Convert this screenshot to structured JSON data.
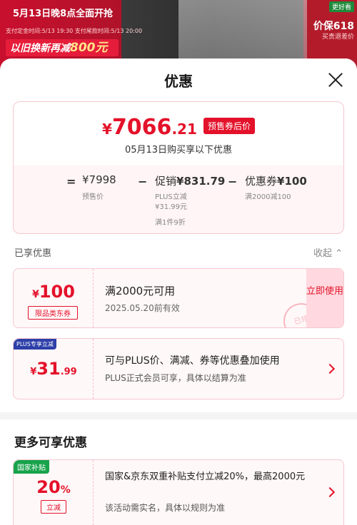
{
  "background": {
    "banner_line1": "5月13日晚8点全面开抢",
    "banner_line2": "支付定金时间:5/13 19:30   支付尾款时间:5/13 20:00",
    "banner_promo_prefix": "以旧换新再减",
    "banner_promo_amount": "800元",
    "right_badge": "更好看",
    "right_big": "价保618",
    "right_small": "买贵退差价"
  },
  "sheet": {
    "title": "优惠"
  },
  "summary": {
    "currency": "¥",
    "price_int": "7066",
    "price_dec": ".21",
    "price_tag": "预售券后价",
    "buy_date": "05月13日购买享以下优惠",
    "equals": "=",
    "presale_price": "¥7998",
    "presale_label": "预售价",
    "minus1": "−",
    "promo_label": "促销",
    "promo_amount": "¥831.79",
    "promo_sub1": "PLUS立减",
    "promo_sub2": "¥31.99元",
    "promo_sub3": "满1件9折",
    "minus2": "−",
    "coupon_label": "优惠券",
    "coupon_amount": "¥100",
    "coupon_sub": "满2000减100"
  },
  "enjoyed": {
    "title": "已享优惠",
    "collapse": "收起"
  },
  "coupons": [
    {
      "currency": "¥",
      "amount": "100",
      "limit": "限品类东券",
      "condition": "满2000元可用",
      "expiry": "2025.05.20前有效",
      "action": "立即使用",
      "stamp": "已领"
    },
    {
      "tag": "PLUS专享立减",
      "currency": "¥",
      "amount_int": "31",
      "amount_dec": ".99",
      "desc1": "可与PLUS价、满减、券等优惠叠加使用",
      "desc2": "PLUS正式会员可享，具体以结算为准"
    }
  ],
  "more": {
    "title": "更多可享优惠",
    "item": {
      "tag": "国家补贴",
      "amount": "20",
      "unit": "%",
      "kind": "立减",
      "desc1": "国家&京东双重补贴支付立减20%，最高2000元",
      "desc2": "该活动需实名，具体以规则为准"
    }
  },
  "colors": {
    "accent_red": "#e4112a",
    "gov_green": "#17a34a",
    "plus_blue": "#2d3fa8"
  }
}
